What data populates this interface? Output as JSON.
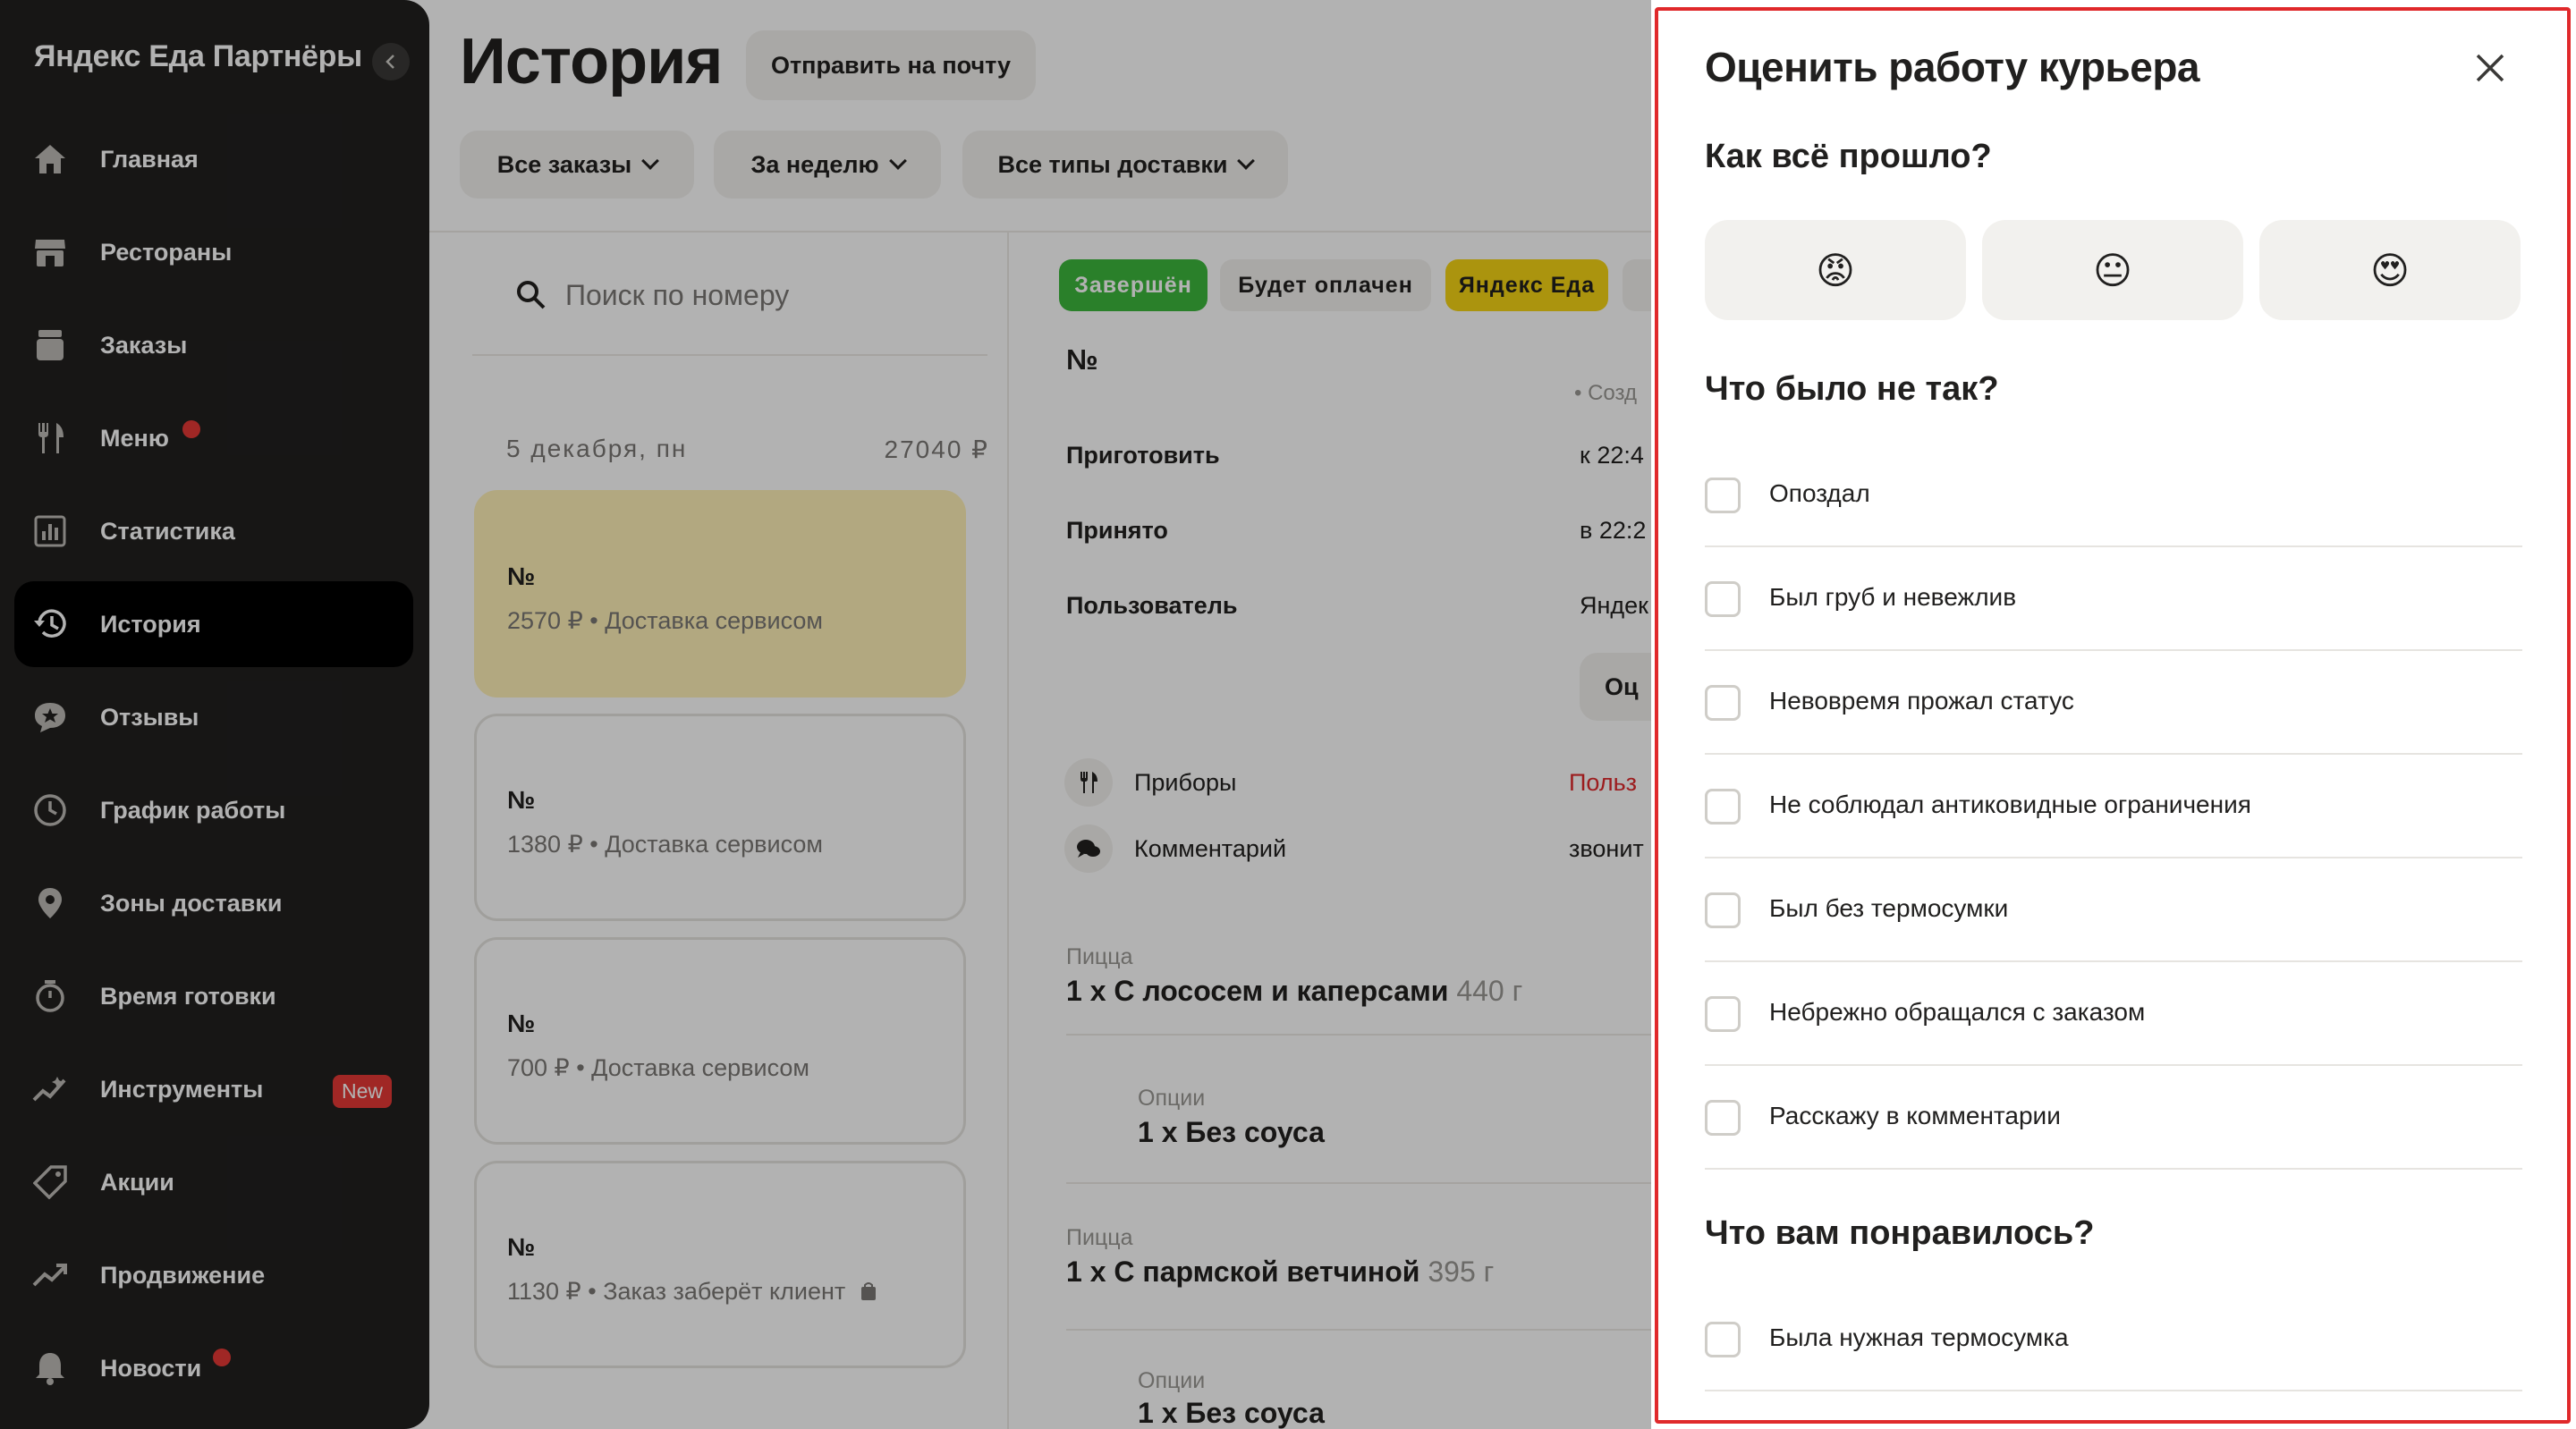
{
  "sidebar": {
    "brand": "Яндекс Еда Партнёры",
    "items": [
      {
        "label": "Главная",
        "icon": "home-icon"
      },
      {
        "label": "Рестораны",
        "icon": "store-icon"
      },
      {
        "label": "Заказы",
        "icon": "orders-icon"
      },
      {
        "label": "Меню",
        "icon": "fork-knife-icon",
        "dot": true
      },
      {
        "label": "Статистика",
        "icon": "chart-icon"
      },
      {
        "label": "История",
        "icon": "history-icon",
        "active": true
      },
      {
        "label": "Отзывы",
        "icon": "reviews-icon"
      },
      {
        "label": "График работы",
        "icon": "clock-icon"
      },
      {
        "label": "Зоны доставки",
        "icon": "pin-icon"
      },
      {
        "label": "Время готовки",
        "icon": "stopwatch-icon"
      },
      {
        "label": "Инструменты",
        "icon": "tools-icon",
        "badge": "New"
      },
      {
        "label": "Акции",
        "icon": "tag-icon"
      },
      {
        "label": "Продвижение",
        "icon": "trend-icon"
      },
      {
        "label": "Новости",
        "icon": "bell-icon",
        "dot": true
      }
    ]
  },
  "main": {
    "title": "История",
    "email_button": "Отправить на почту",
    "filters": [
      "Все заказы",
      "За неделю",
      "Все типы доставки"
    ],
    "search_placeholder": "Поиск по номеру",
    "day": {
      "date": "5 декабря, пн",
      "sum": "27040 ₽"
    },
    "orders": [
      {
        "no": "№",
        "info": "2570 ₽ • Доставка сервисом",
        "selected": true
      },
      {
        "no": "№",
        "info": "1380 ₽ • Доставка сервисом"
      },
      {
        "no": "№",
        "info": "700 ₽ • Доставка сервисом"
      },
      {
        "no": "№",
        "info": "1130 ₽ • Заказ заберёт клиент"
      }
    ],
    "tags": [
      "Завершён",
      "Будет оплачен",
      "Яндекс Еда"
    ],
    "detail": {
      "no": "№",
      "created": "• Созд",
      "rows": [
        {
          "label": "Приготовить",
          "value": "к 22:4"
        },
        {
          "label": "Принято",
          "value": "в 22:2"
        },
        {
          "label": "Пользователь",
          "value": "Яндек"
        }
      ],
      "rate_button": "Оц",
      "cutlery_label": "Приборы",
      "cutlery_value": "Польз",
      "comment_label": "Комментарий",
      "comment_value": "звонит",
      "items": [
        {
          "category": "Пицца",
          "name": "1 x С лососем и каперсами",
          "weight": "440 г"
        },
        {
          "category": "Опции",
          "name": "1 x Без соуса"
        },
        {
          "category": "Пицца",
          "name": "1 x С пармской ветчиной",
          "weight": "395 г"
        },
        {
          "category": "Опции",
          "name": "1 x Без соуса"
        }
      ]
    }
  },
  "modal": {
    "title": "Оценить работу курьера",
    "q_how": "Как всё прошло?",
    "moods": [
      "😡",
      "😐",
      "😍"
    ],
    "q_wrong": "Что было не так?",
    "wrong_options": [
      "Опоздал",
      "Был груб и невежлив",
      "Невовремя прожал статус",
      "Не соблюдал антиковидные ограничения",
      "Был без термосумки",
      "Небрежно обращался с заказом",
      "Расскажу в комментарии"
    ],
    "q_liked": "Что вам понравилось?",
    "liked_options": [
      "Была нужная термосумка"
    ]
  },
  "colors": {
    "sidebar_bg": "#21201f",
    "accent_red": "#e53935",
    "selected_card": "#fff1b8",
    "tag_green": "#3db83d",
    "tag_yellow": "#f5d415",
    "highlight_frame": "#e0292b"
  }
}
